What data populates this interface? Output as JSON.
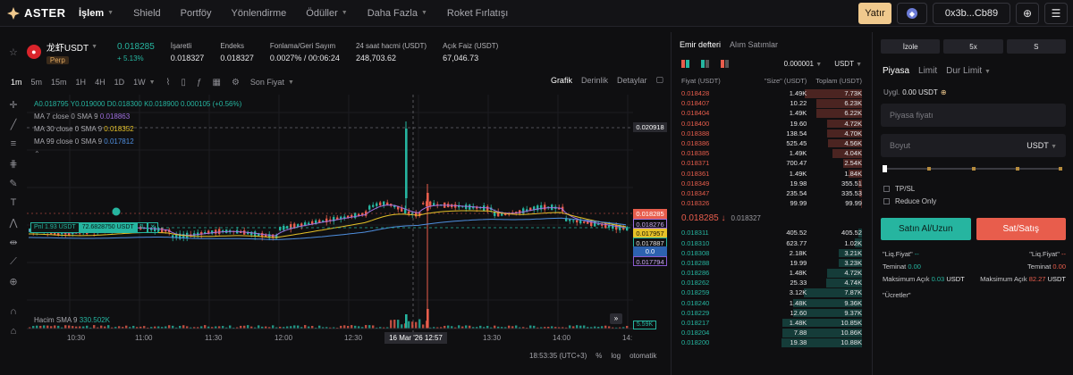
{
  "nav": {
    "brand": "ASTER",
    "items": [
      {
        "label": "İşlem",
        "caret": true,
        "active": true
      },
      {
        "label": "Shield",
        "caret": false
      },
      {
        "label": "Portföy",
        "caret": false
      },
      {
        "label": "Yönlendirme",
        "caret": false
      },
      {
        "label": "Ödüller",
        "caret": true
      },
      {
        "label": "Daha Fazla",
        "caret": true
      },
      {
        "label": "Roket Fırlatışı",
        "caret": false
      }
    ],
    "deposit_label": "Yatır",
    "wallet_label": "0x3b...Cb89",
    "colors": {
      "accent": "#f0c98d",
      "buy": "#26b5a0",
      "sell": "#e85d4c"
    }
  },
  "symbol": {
    "name": "龙虾USDT",
    "badge": "Perp",
    "price": "0.018285",
    "change": "+ 5.13%",
    "stats": [
      {
        "label": "İşaretli",
        "value": "0.018327"
      },
      {
        "label": "Endeks",
        "value": "0.018327"
      },
      {
        "label": "Fonlama/Geri Sayım",
        "value": "0.0027% / 00:06:24"
      },
      {
        "label": "24 saat hacmi (USDT)",
        "value": "248,703.62"
      },
      {
        "label": "Açık Faiz (USDT)",
        "value": "67,046.73"
      }
    ]
  },
  "chart_toolbar": {
    "timeframes": [
      "1m",
      "5m",
      "15m",
      "1H",
      "4H",
      "1D",
      "1W"
    ],
    "active_timeframe": "1m",
    "price_mode": "Son Fiyat",
    "views": [
      "Grafik",
      "Derinlik",
      "Detaylar"
    ],
    "active_view": "Grafik"
  },
  "legend": {
    "ohlc": "A0.018795  Y0.019000  D0.018300  K0.018900  0.000105 (+0.56%)",
    "ma7_label": "MA 7 close 0 SMA 9",
    "ma7_value": "0.018863",
    "ma30_label": "MA 30 close 0 SMA 9",
    "ma30_value": "0.018352",
    "ma99_label": "MA 99 close 0 SMA 9",
    "ma99_value": "0.017812",
    "volume_label": "Hacim SMA 9",
    "volume_value": "330.502K",
    "volume_tag": "5.59K",
    "colors": {
      "ma7": "#a070e0",
      "ma30": "#e6c228",
      "ma99": "#4f8fe0"
    }
  },
  "position_tag": {
    "pnl": "Pnl 1.93 USDT",
    "size": "72.6828750 USDT",
    "flip": "⇅",
    "close": "✕"
  },
  "price_tags": {
    "crosshair": "0.020918",
    "last": "0.018285",
    "ma7": "0.018276",
    "ma30": "0.017957",
    "ma99": "0.017887",
    "zero": "0.0",
    "low": "0.017794"
  },
  "x_axis": {
    "ticks": [
      "10:30",
      "11:00",
      "11:30",
      "12:00",
      "12:30",
      "13:30",
      "14:00",
      "14:"
    ],
    "crosshair_label": "16 Mar '26   12:57"
  },
  "chart_footer": {
    "time": "18:53:35 (UTC+3)",
    "pct": "%",
    "log": "log",
    "auto": "otomatik"
  },
  "chart_data": {
    "type": "candlestick",
    "asks_legend": "MA 7 / MA 30 / MA 99",
    "axis_ranges": {
      "y": [
        0.0165,
        0.0215
      ]
    },
    "grid": true
  },
  "orderbook": {
    "tabs": [
      "Emir defteri",
      "Alım Satımlar"
    ],
    "active_tab": "Emir defteri",
    "tick": "0.000001",
    "unit": "USDT",
    "headers": [
      "Fiyat (USDT)",
      "\"Size\" (USDT)",
      "Toplam (USDT)"
    ],
    "asks": [
      {
        "price": "0.018428",
        "size": "1.49K",
        "total": "7.73K",
        "depth": 0.71
      },
      {
        "price": "0.018407",
        "size": "10.22",
        "total": "6.23K",
        "depth": 0.57
      },
      {
        "price": "0.018404",
        "size": "1.49K",
        "total": "6.22K",
        "depth": 0.57
      },
      {
        "price": "0.018400",
        "size": "19.60",
        "total": "4.72K",
        "depth": 0.43
      },
      {
        "price": "0.018388",
        "size": "138.54",
        "total": "4.70K",
        "depth": 0.43
      },
      {
        "price": "0.018386",
        "size": "525.45",
        "total": "4.56K",
        "depth": 0.42
      },
      {
        "price": "0.018385",
        "size": "1.49K",
        "total": "4.04K",
        "depth": 0.37
      },
      {
        "price": "0.018371",
        "size": "700.47",
        "total": "2.54K",
        "depth": 0.23
      },
      {
        "price": "0.018361",
        "size": "1.49K",
        "total": "1.84K",
        "depth": 0.17
      },
      {
        "price": "0.018349",
        "size": "19.98",
        "total": "355.51",
        "depth": 0.04
      },
      {
        "price": "0.018347",
        "size": "235.54",
        "total": "335.53",
        "depth": 0.03
      },
      {
        "price": "0.018326",
        "size": "99.99",
        "total": "99.99",
        "depth": 0.01
      }
    ],
    "mid_price": "0.018285",
    "mid_arrow": "↓",
    "mid_index": "0.018327",
    "bids": [
      {
        "price": "0.018311",
        "size": "405.52",
        "total": "405.52",
        "depth": 0.04
      },
      {
        "price": "0.018310",
        "size": "623.77",
        "total": "1.02K",
        "depth": 0.09
      },
      {
        "price": "0.018308",
        "size": "2.18K",
        "total": "3.21K",
        "depth": 0.29
      },
      {
        "price": "0.018288",
        "size": "19.99",
        "total": "3.23K",
        "depth": 0.29
      },
      {
        "price": "0.018286",
        "size": "1.48K",
        "total": "4.72K",
        "depth": 0.43
      },
      {
        "price": "0.018262",
        "size": "25.33",
        "total": "4.74K",
        "depth": 0.44
      },
      {
        "price": "0.018259",
        "size": "3.12K",
        "total": "7.87K",
        "depth": 0.72
      },
      {
        "price": "0.018240",
        "size": "1.48K",
        "total": "9.36K",
        "depth": 0.86
      },
      {
        "price": "0.018229",
        "size": "12.60",
        "total": "9.37K",
        "depth": 0.86
      },
      {
        "price": "0.018217",
        "size": "1.48K",
        "total": "10.85K",
        "depth": 0.99
      },
      {
        "price": "0.018204",
        "size": "7.88",
        "total": "10.86K",
        "depth": 0.99
      },
      {
        "price": "0.018200",
        "size": "19.38",
        "total": "10.88K",
        "depth": 1.0
      }
    ]
  },
  "order_panel": {
    "margin_mode": "İzole",
    "leverage": "5x",
    "side_tag": "S",
    "order_types": [
      "Piyasa",
      "Limit",
      "Dur Limit"
    ],
    "active_type": "Piyasa",
    "available_label": "Uygl.",
    "available_value": "0.00 USDT",
    "price_placeholder": "Piyasa fiyatı",
    "size_placeholder": "Boyut",
    "size_unit": "USDT",
    "tpsl_label": "TP/SL",
    "reduce_label": "Reduce Only",
    "buy_label": "Satın Al/Uzun",
    "sell_label": "Sat/Satış",
    "buy_liq_label": "\"Liq.Fiyat\"",
    "buy_liq_value": "--",
    "sell_liq_label": "\"Liq.Fiyat\"",
    "sell_liq_value": "--",
    "buy_margin_label": "Teminat",
    "buy_margin_value": "0.00",
    "sell_margin_label": "Teminat",
    "sell_margin_value": "0.00",
    "buy_max_label": "Maksimum Açık",
    "buy_max_value": "0.03",
    "buy_max_unit": "USDT",
    "sell_max_label": "Maksimum Açık",
    "sell_max_value": "82.27",
    "sell_max_unit": "USDT",
    "fees_label": "\"Ücretler\""
  }
}
